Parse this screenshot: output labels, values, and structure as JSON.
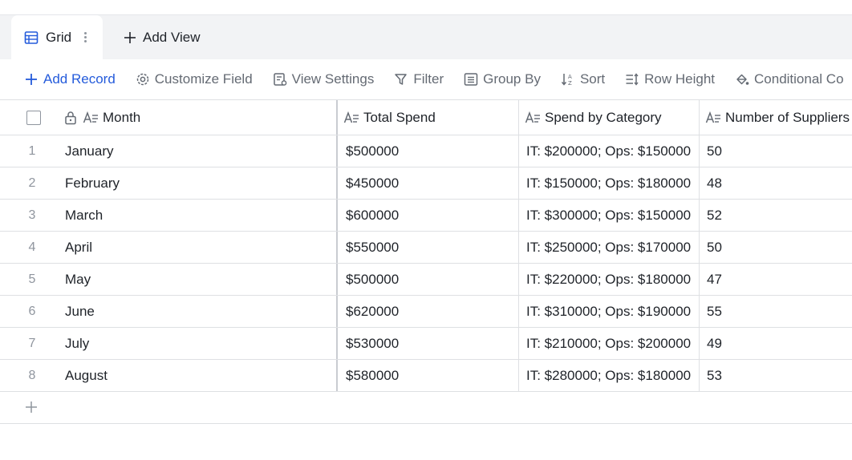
{
  "views": {
    "active_tab": {
      "label": "Grid",
      "icon": "grid-icon"
    },
    "add_view_label": "Add View"
  },
  "toolbar": {
    "add_record": "Add Record",
    "customize_field": "Customize Field",
    "view_settings": "View Settings",
    "filter": "Filter",
    "group_by": "Group By",
    "sort": "Sort",
    "row_height": "Row Height",
    "conditional": "Conditional Co"
  },
  "table": {
    "columns": [
      "Month",
      "Total Spend",
      "Spend by Category",
      "Number of Suppliers"
    ],
    "rows": [
      {
        "index": "1",
        "month": "January",
        "total": "$500000",
        "category": "IT: $200000; Ops: $150000",
        "suppliers": "50"
      },
      {
        "index": "2",
        "month": "February",
        "total": "$450000",
        "category": "IT: $150000; Ops: $180000",
        "suppliers": "48"
      },
      {
        "index": "3",
        "month": "March",
        "total": "$600000",
        "category": "IT: $300000; Ops: $150000",
        "suppliers": "52"
      },
      {
        "index": "4",
        "month": "April",
        "total": "$550000",
        "category": "IT: $250000; Ops: $170000",
        "suppliers": "50"
      },
      {
        "index": "5",
        "month": "May",
        "total": "$500000",
        "category": "IT: $220000; Ops: $180000",
        "suppliers": "47"
      },
      {
        "index": "6",
        "month": "June",
        "total": "$620000",
        "category": "IT: $310000; Ops: $190000",
        "suppliers": "55"
      },
      {
        "index": "7",
        "month": "July",
        "total": "$530000",
        "category": "IT: $210000; Ops: $200000",
        "suppliers": "49"
      },
      {
        "index": "8",
        "month": "August",
        "total": "$580000",
        "category": "IT: $280000; Ops: $180000",
        "suppliers": "53"
      }
    ]
  },
  "colors": {
    "accent": "#245bdb",
    "muted": "#646a73",
    "border": "#dee0e3"
  }
}
